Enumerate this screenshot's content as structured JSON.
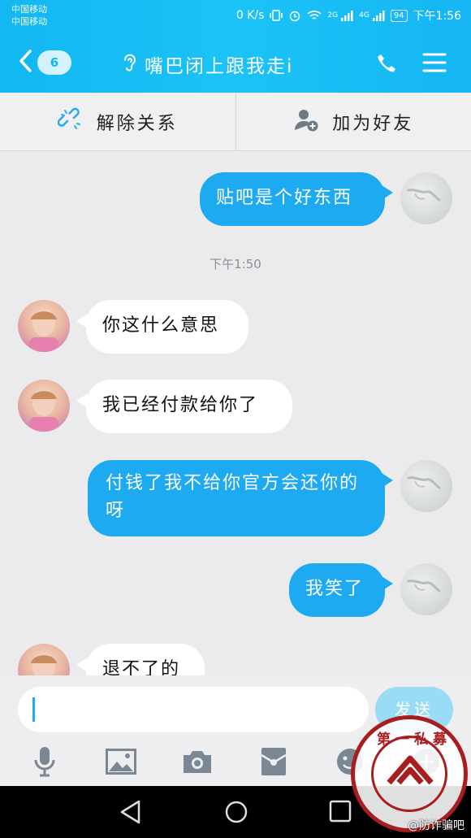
{
  "status_bar": {
    "carrier_line1": "中国移动",
    "carrier_line2": "中国移动",
    "net_speed": "0 K/s",
    "signal_2g": "2G",
    "signal_4g": "4G",
    "battery": "94",
    "time": "下午1:56"
  },
  "header": {
    "back_badge": "6",
    "title": "嘴巴闭上跟我走i",
    "icons": [
      "back-chevron-icon",
      "ear-icon",
      "phone-icon",
      "menu-icon"
    ]
  },
  "action_bar": {
    "unlink_label": "解除关系",
    "add_friend_label": "加为好友"
  },
  "chat": {
    "timestamp": "下午1:50",
    "messages": [
      {
        "from": "me",
        "text": "贴吧是个好东西"
      },
      {
        "from": "other",
        "text": "你这什么意思"
      },
      {
        "from": "other",
        "text": "我已经付款给你了"
      },
      {
        "from": "me",
        "text": "付钱了我不给你官方会还你的呀"
      },
      {
        "from": "me",
        "text": "我笑了"
      },
      {
        "from": "other",
        "text": "退不了的"
      }
    ]
  },
  "input": {
    "value": "",
    "send_label": "发送"
  },
  "toolbar": {
    "icons": [
      "microphone-icon",
      "image-icon",
      "camera-icon",
      "red-packet-icon",
      "emoji-icon",
      "plus-icon"
    ]
  },
  "watermark": {
    "seal_text": "第一私募",
    "credit": "@防诈骗吧"
  },
  "colors": {
    "header_blue": "#12b7f3",
    "bubble_blue": "#1daaf1",
    "send_disabled": "#9adcf5",
    "seal_red": "#a81e1e"
  }
}
